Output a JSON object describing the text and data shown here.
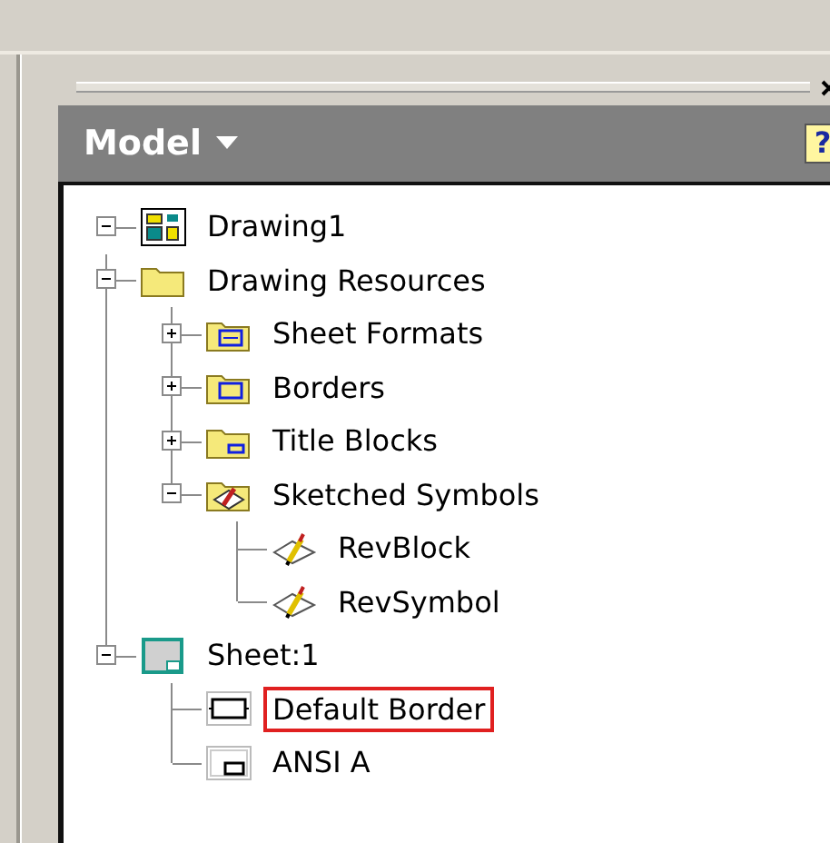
{
  "panel": {
    "title": "Model",
    "help_button": "?"
  },
  "tree": [
    {
      "label": "Drawing1",
      "kind": "drawing",
      "expanded": true,
      "highlighted": false,
      "children": [
        {
          "label": "Drawing Resources",
          "kind": "folder",
          "expanded": true,
          "highlighted": false,
          "children": [
            {
              "label": "Sheet Formats",
              "kind": "folder-sheet",
              "expanded": false,
              "highlighted": false
            },
            {
              "label": "Borders",
              "kind": "folder-border",
              "expanded": false,
              "highlighted": false
            },
            {
              "label": "Title Blocks",
              "kind": "folder-title",
              "expanded": false,
              "highlighted": false
            },
            {
              "label": "Sketched Symbols",
              "kind": "folder-symbol",
              "expanded": true,
              "highlighted": false,
              "children": [
                {
                  "label": "RevBlock",
                  "kind": "symbol",
                  "highlighted": false
                },
                {
                  "label": "RevSymbol",
                  "kind": "symbol",
                  "highlighted": false
                }
              ]
            }
          ]
        },
        {
          "label": "Sheet:1",
          "kind": "sheet",
          "expanded": true,
          "highlighted": false,
          "children": [
            {
              "label": "Default Border",
              "kind": "border",
              "highlighted": true
            },
            {
              "label": "ANSI A",
              "kind": "title-block",
              "highlighted": false
            }
          ]
        }
      ]
    }
  ]
}
